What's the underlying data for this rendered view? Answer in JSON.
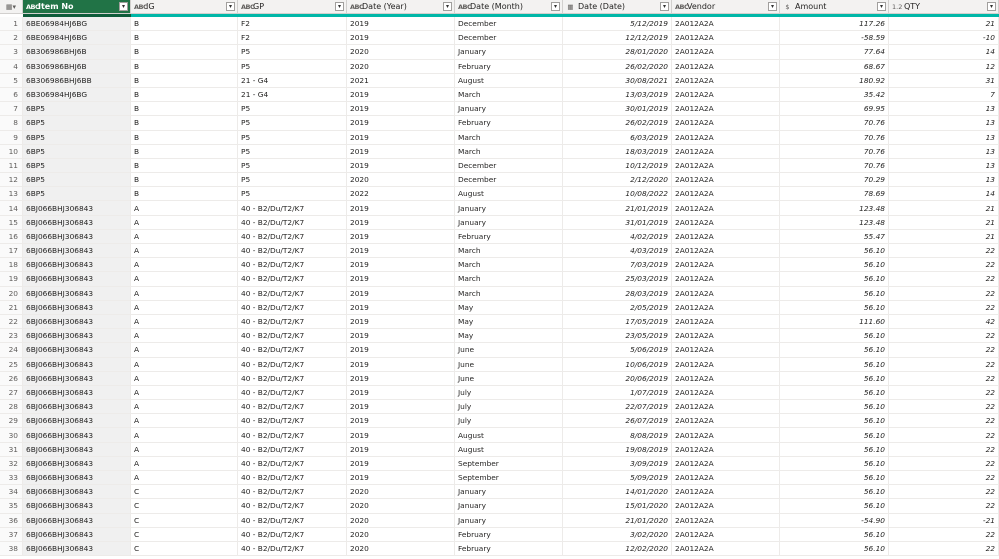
{
  "columns": [
    {
      "key": "item",
      "name": "Item No",
      "type_icon": "ABC",
      "type_name": "text-type-icon"
    },
    {
      "key": "ig",
      "name": "IG",
      "type_icon": "ABC",
      "type_name": "text-type-icon"
    },
    {
      "key": "gp",
      "name": "GP",
      "type_icon": "ABC",
      "type_name": "text-type-icon"
    },
    {
      "key": "year",
      "name": "Date (Year)",
      "type_icon": "ABC",
      "type_name": "text-type-icon"
    },
    {
      "key": "month",
      "name": "Date (Month)",
      "type_icon": "ABC",
      "type_name": "text-type-icon"
    },
    {
      "key": "date",
      "name": "Date (Date)",
      "type_icon": "▦",
      "type_name": "date-type-icon"
    },
    {
      "key": "vendor",
      "name": "Vendor",
      "type_icon": "ABC",
      "type_name": "text-type-icon"
    },
    {
      "key": "amount",
      "name": "Amount",
      "type_icon": "$",
      "type_name": "currency-type-icon"
    },
    {
      "key": "qty",
      "name": "QTY",
      "type_icon": "1.2",
      "type_name": "decimal-type-icon"
    }
  ],
  "rows": [
    [
      "6BE06984HJ6BG",
      "B",
      "F2",
      "2019",
      "December",
      "5/12/2019",
      "2A012A2A",
      "117.26",
      "21"
    ],
    [
      "6BE06984HJ6BG",
      "B",
      "F2",
      "2019",
      "December",
      "12/12/2019",
      "2A012A2A",
      "-58.59",
      "-10"
    ],
    [
      "6B306986BHJ6B",
      "B",
      "P5",
      "2020",
      "January",
      "28/01/2020",
      "2A012A2A",
      "77.64",
      "14"
    ],
    [
      "6B306986BHJ6B",
      "B",
      "P5",
      "2020",
      "February",
      "26/02/2020",
      "2A012A2A",
      "68.67",
      "12"
    ],
    [
      "6B306986BHJ6BB",
      "B",
      "21 - G4",
      "2021",
      "August",
      "30/08/2021",
      "2A012A2A",
      "180.92",
      "31"
    ],
    [
      "6B306984HJ6BG",
      "B",
      "21 - G4",
      "2019",
      "March",
      "13/03/2019",
      "2A012A2A",
      "35.42",
      "7"
    ],
    [
      "6BP5",
      "B",
      "P5",
      "2019",
      "January",
      "30/01/2019",
      "2A012A2A",
      "69.95",
      "13"
    ],
    [
      "6BP5",
      "B",
      "P5",
      "2019",
      "February",
      "26/02/2019",
      "2A012A2A",
      "70.76",
      "13"
    ],
    [
      "6BP5",
      "B",
      "P5",
      "2019",
      "March",
      "6/03/2019",
      "2A012A2A",
      "70.76",
      "13"
    ],
    [
      "6BP5",
      "B",
      "P5",
      "2019",
      "March",
      "18/03/2019",
      "2A012A2A",
      "70.76",
      "13"
    ],
    [
      "6BP5",
      "B",
      "P5",
      "2019",
      "December",
      "10/12/2019",
      "2A012A2A",
      "70.76",
      "13"
    ],
    [
      "6BP5",
      "B",
      "P5",
      "2020",
      "December",
      "2/12/2020",
      "2A012A2A",
      "70.29",
      "13"
    ],
    [
      "6BP5",
      "B",
      "P5",
      "2022",
      "August",
      "10/08/2022",
      "2A012A2A",
      "78.69",
      "14"
    ],
    [
      "6BJ066BHJ306843",
      "A",
      "40 - B2/Du/T2/K7",
      "2019",
      "January",
      "21/01/2019",
      "2A012A2A",
      "123.48",
      "21"
    ],
    [
      "6BJ066BHJ306843",
      "A",
      "40 - B2/Du/T2/K7",
      "2019",
      "January",
      "31/01/2019",
      "2A012A2A",
      "123.48",
      "21"
    ],
    [
      "6BJ066BHJ306843",
      "A",
      "40 - B2/Du/T2/K7",
      "2019",
      "February",
      "4/02/2019",
      "2A012A2A",
      "55.47",
      "21"
    ],
    [
      "6BJ066BHJ306843",
      "A",
      "40 - B2/Du/T2/K7",
      "2019",
      "March",
      "4/03/2019",
      "2A012A2A",
      "56.10",
      "22"
    ],
    [
      "6BJ066BHJ306843",
      "A",
      "40 - B2/Du/T2/K7",
      "2019",
      "March",
      "7/03/2019",
      "2A012A2A",
      "56.10",
      "22"
    ],
    [
      "6BJ066BHJ306843",
      "A",
      "40 - B2/Du/T2/K7",
      "2019",
      "March",
      "25/03/2019",
      "2A012A2A",
      "56.10",
      "22"
    ],
    [
      "6BJ066BHJ306843",
      "A",
      "40 - B2/Du/T2/K7",
      "2019",
      "March",
      "28/03/2019",
      "2A012A2A",
      "56.10",
      "22"
    ],
    [
      "6BJ066BHJ306843",
      "A",
      "40 - B2/Du/T2/K7",
      "2019",
      "May",
      "2/05/2019",
      "2A012A2A",
      "56.10",
      "22"
    ],
    [
      "6BJ066BHJ306843",
      "A",
      "40 - B2/Du/T2/K7",
      "2019",
      "May",
      "17/05/2019",
      "2A012A2A",
      "111.60",
      "42"
    ],
    [
      "6BJ066BHJ306843",
      "A",
      "40 - B2/Du/T2/K7",
      "2019",
      "May",
      "23/05/2019",
      "2A012A2A",
      "56.10",
      "22"
    ],
    [
      "6BJ066BHJ306843",
      "A",
      "40 - B2/Du/T2/K7",
      "2019",
      "June",
      "5/06/2019",
      "2A012A2A",
      "56.10",
      "22"
    ],
    [
      "6BJ066BHJ306843",
      "A",
      "40 - B2/Du/T2/K7",
      "2019",
      "June",
      "10/06/2019",
      "2A012A2A",
      "56.10",
      "22"
    ],
    [
      "6BJ066BHJ306843",
      "A",
      "40 - B2/Du/T2/K7",
      "2019",
      "June",
      "20/06/2019",
      "2A012A2A",
      "56.10",
      "22"
    ],
    [
      "6BJ066BHJ306843",
      "A",
      "40 - B2/Du/T2/K7",
      "2019",
      "July",
      "1/07/2019",
      "2A012A2A",
      "56.10",
      "22"
    ],
    [
      "6BJ066BHJ306843",
      "A",
      "40 - B2/Du/T2/K7",
      "2019",
      "July",
      "22/07/2019",
      "2A012A2A",
      "56.10",
      "22"
    ],
    [
      "6BJ066BHJ306843",
      "A",
      "40 - B2/Du/T2/K7",
      "2019",
      "July",
      "26/07/2019",
      "2A012A2A",
      "56.10",
      "22"
    ],
    [
      "6BJ066BHJ306843",
      "A",
      "40 - B2/Du/T2/K7",
      "2019",
      "August",
      "8/08/2019",
      "2A012A2A",
      "56.10",
      "22"
    ],
    [
      "6BJ066BHJ306843",
      "A",
      "40 - B2/Du/T2/K7",
      "2019",
      "August",
      "19/08/2019",
      "2A012A2A",
      "56.10",
      "22"
    ],
    [
      "6BJ066BHJ306843",
      "A",
      "40 - B2/Du/T2/K7",
      "2019",
      "September",
      "3/09/2019",
      "2A012A2A",
      "56.10",
      "22"
    ],
    [
      "6BJ066BHJ306843",
      "A",
      "40 - B2/Du/T2/K7",
      "2019",
      "September",
      "5/09/2019",
      "2A012A2A",
      "56.10",
      "22"
    ],
    [
      "6BJ066BHJ306843",
      "C",
      "40 - B2/Du/T2/K7",
      "2020",
      "January",
      "14/01/2020",
      "2A012A2A",
      "56.10",
      "22"
    ],
    [
      "6BJ066BHJ306843",
      "C",
      "40 - B2/Du/T2/K7",
      "2020",
      "January",
      "15/01/2020",
      "2A012A2A",
      "56.10",
      "22"
    ],
    [
      "6BJ066BHJ306843",
      "C",
      "40 - B2/Du/T2/K7",
      "2020",
      "January",
      "21/01/2020",
      "2A012A2A",
      "-54.90",
      "-21"
    ],
    [
      "6BJ066BHJ306843",
      "C",
      "40 - B2/Du/T2/K7",
      "2020",
      "February",
      "3/02/2020",
      "2A012A2A",
      "56.10",
      "22"
    ],
    [
      "6BJ066BHJ306843",
      "C",
      "40 - B2/Du/T2/K7",
      "2020",
      "February",
      "12/02/2020",
      "2A012A2A",
      "56.10",
      "22"
    ]
  ],
  "colors": {
    "selected_header": "#217346",
    "quality_bar": "#00b7a8"
  }
}
